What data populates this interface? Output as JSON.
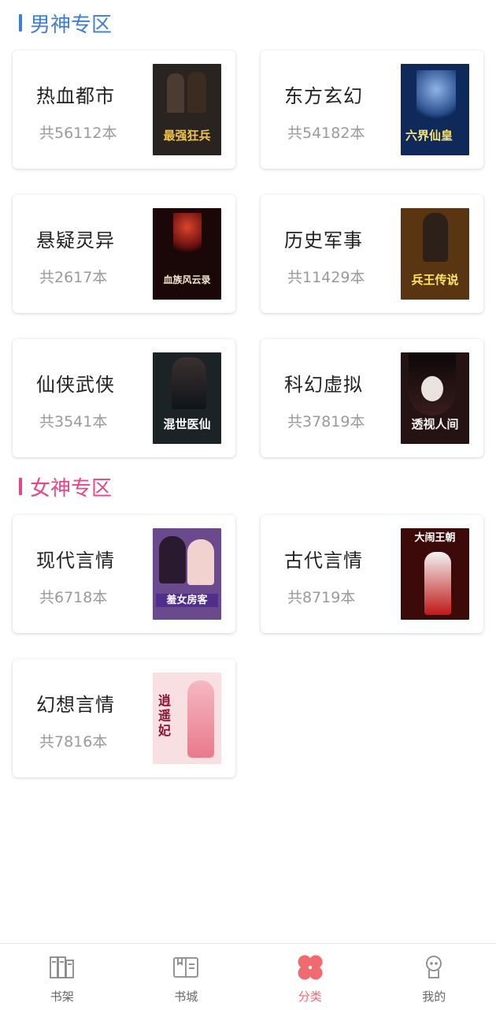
{
  "sections": {
    "male": {
      "title": "男神专区",
      "accent": "#3e7fd6",
      "categories": [
        {
          "name": "热血都市",
          "count": "共56112本",
          "cover_title": "最强狂兵",
          "cover_author": "",
          "cover_bg": "#2a2420",
          "cover_fg": "#f3c343"
        },
        {
          "name": "东方玄幻",
          "count": "共54182本",
          "cover_title": "六界仙皇",
          "cover_author": "",
          "cover_bg": "#0f2a5a",
          "cover_fg": "#f5e27a"
        },
        {
          "name": "悬疑灵异",
          "count": "共2617本",
          "cover_title": "血族风云录",
          "cover_author": "",
          "cover_bg": "#1a0707",
          "cover_fg": "#f2e6c8"
        },
        {
          "name": "历史军事",
          "count": "共11429本",
          "cover_title": "兵王传说",
          "cover_author": "",
          "cover_bg": "#5a3512",
          "cover_fg": "#ffe46a"
        },
        {
          "name": "仙侠武侠",
          "count": "共3541本",
          "cover_title": "混世医仙",
          "cover_author": "",
          "cover_bg": "#1c2326",
          "cover_fg": "#ffffff"
        },
        {
          "name": "科幻虚拟",
          "count": "共37819本",
          "cover_title": "透视人间",
          "cover_author": "",
          "cover_bg": "#251313",
          "cover_fg": "#f3f3f3"
        }
      ]
    },
    "female": {
      "title": "女神专区",
      "accent": "#e8458a",
      "categories": [
        {
          "name": "现代言情",
          "count": "共6718本",
          "cover_title": "羞女房客",
          "cover_author": "",
          "cover_bg": "#6a4a8c",
          "cover_fg": "#ffffff"
        },
        {
          "name": "古代言情",
          "count": "共8719本",
          "cover_title": "大闹王朝",
          "cover_author": "",
          "cover_bg": "#3d0a0a",
          "cover_fg": "#ffffff"
        },
        {
          "name": "幻想言情",
          "count": "共7816本",
          "cover_title": "逍遥妃",
          "cover_author": "",
          "cover_bg": "#f7dfe2",
          "cover_fg": "#8a1030"
        }
      ]
    }
  },
  "tabbar": {
    "active_color": "#f06a72",
    "items": [
      {
        "label": "书架",
        "icon": "bookshelf-icon",
        "active": false
      },
      {
        "label": "书城",
        "icon": "open-book-icon",
        "active": false
      },
      {
        "label": "分类",
        "icon": "category-petals-icon",
        "active": true
      },
      {
        "label": "我的",
        "icon": "profile-icon",
        "active": false
      }
    ]
  }
}
